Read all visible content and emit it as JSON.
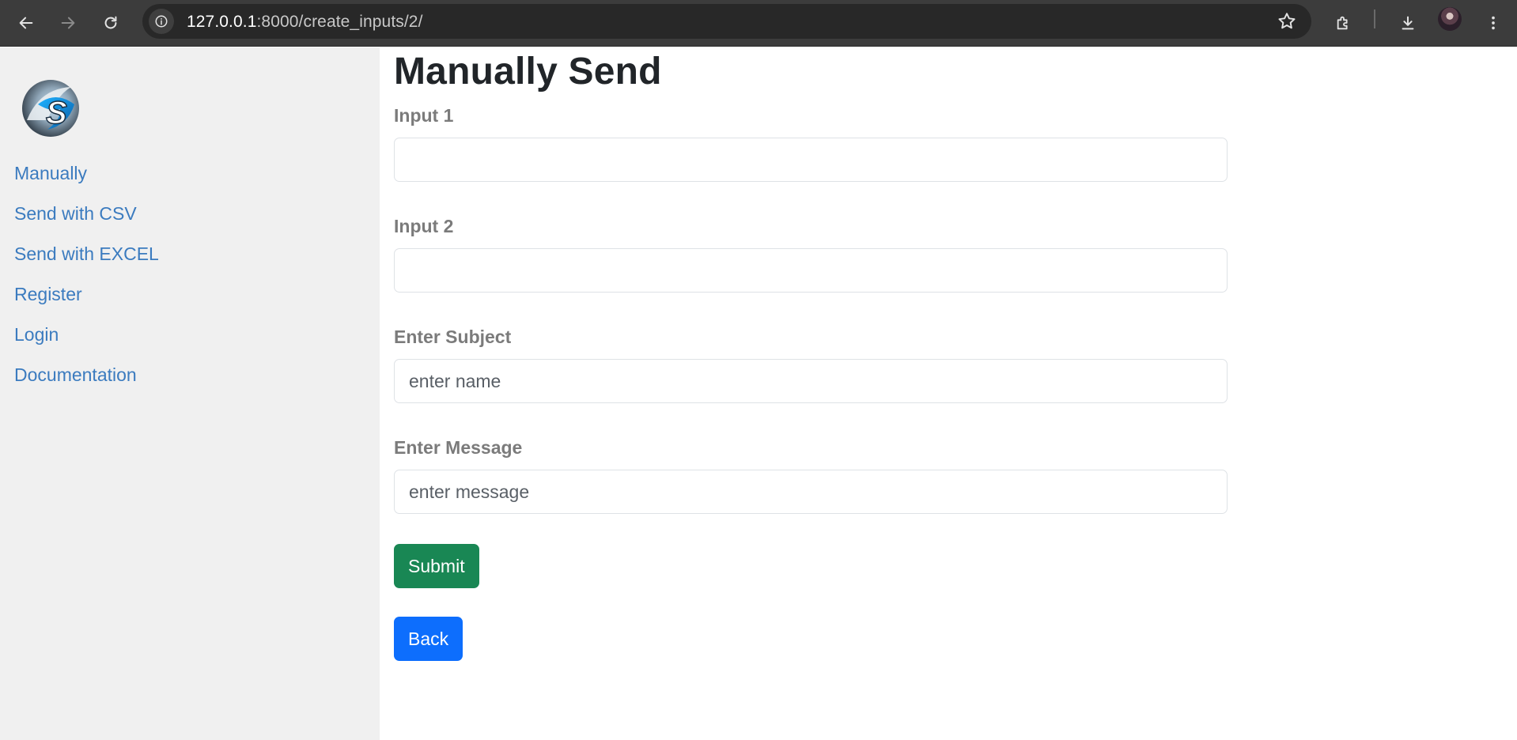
{
  "browser": {
    "url_host": "127.0.0.1",
    "url_path": ":8000/create_inputs/2/"
  },
  "sidebar": {
    "logo_text": "S",
    "items": [
      {
        "label": "Manually"
      },
      {
        "label": "Send with CSV"
      },
      {
        "label": "Send with EXCEL"
      },
      {
        "label": "Register"
      },
      {
        "label": "Login"
      },
      {
        "label": "Documentation"
      }
    ]
  },
  "main": {
    "title": "Manually Send",
    "fields": [
      {
        "label": "Input 1",
        "value": "",
        "placeholder": ""
      },
      {
        "label": "Input 2",
        "value": "",
        "placeholder": ""
      },
      {
        "label": "Enter Subject",
        "value": "",
        "placeholder": "enter name"
      },
      {
        "label": "Enter Message",
        "value": "",
        "placeholder": "enter message"
      }
    ],
    "submit_label": "Submit",
    "back_label": "Back"
  },
  "colors": {
    "link": "#3b7bbf",
    "submit": "#198754",
    "back": "#0d6efd"
  }
}
